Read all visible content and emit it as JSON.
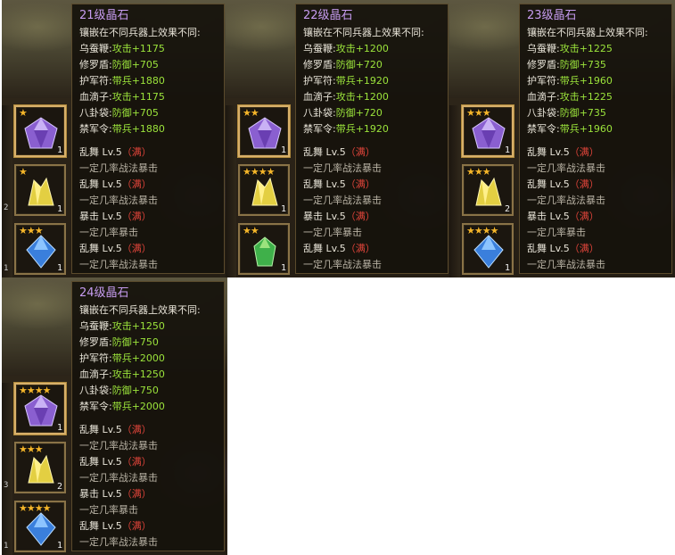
{
  "panels": [
    {
      "title": "21级晶石",
      "header": "镶嵌在不同兵器上效果不同:",
      "stats": [
        {
          "label": "乌蚕鞭:",
          "value": "攻击+1175"
        },
        {
          "label": "修罗盾:",
          "value": "防御+705"
        },
        {
          "label": "护军符:",
          "value": "带兵+1880"
        },
        {
          "label": "血滴子:",
          "value": "攻击+1175"
        },
        {
          "label": "八卦袋:",
          "value": "防御+705"
        },
        {
          "label": "禁军令:",
          "value": "带兵+1880"
        }
      ],
      "slot_qty": [
        "1",
        "1",
        "1"
      ],
      "slot_stars": [
        "★",
        "★",
        "★★★"
      ],
      "edge_nums": [
        "2",
        "1"
      ]
    },
    {
      "title": "22级晶石",
      "header": "镶嵌在不同兵器上效果不同:",
      "stats": [
        {
          "label": "乌蚕鞭:",
          "value": "攻击+1200"
        },
        {
          "label": "修罗盾:",
          "value": "防御+720"
        },
        {
          "label": "护军符:",
          "value": "带兵+1920"
        },
        {
          "label": "血滴子:",
          "value": "攻击+1200"
        },
        {
          "label": "八卦袋:",
          "value": "防御+720"
        },
        {
          "label": "禁军令:",
          "value": "带兵+1920"
        }
      ],
      "slot_qty": [
        "1",
        "1",
        "1"
      ],
      "slot_stars": [
        "★★",
        "★★★★",
        "★★"
      ],
      "edge_nums": [
        "",
        ""
      ]
    },
    {
      "title": "23级晶石",
      "header": "镶嵌在不同兵器上效果不同:",
      "stats": [
        {
          "label": "乌蚕鞭:",
          "value": "攻击+1225"
        },
        {
          "label": "修罗盾:",
          "value": "防御+735"
        },
        {
          "label": "护军符:",
          "value": "带兵+1960"
        },
        {
          "label": "血滴子:",
          "value": "攻击+1225"
        },
        {
          "label": "八卦袋:",
          "value": "防御+735"
        },
        {
          "label": "禁军令:",
          "value": "带兵+1960"
        }
      ],
      "slot_qty": [
        "1",
        "2",
        "1"
      ],
      "slot_stars": [
        "★★★",
        "★★★",
        "★★★★"
      ],
      "edge_nums": [
        "",
        ""
      ]
    },
    {
      "title": "24级晶石",
      "header": "镶嵌在不同兵器上效果不同:",
      "stats": [
        {
          "label": "乌蚕鞭:",
          "value": "攻击+1250"
        },
        {
          "label": "修罗盾:",
          "value": "防御+750"
        },
        {
          "label": "护军符:",
          "value": "带兵+2000"
        },
        {
          "label": "血滴子:",
          "value": "攻击+1250"
        },
        {
          "label": "八卦袋:",
          "value": "防御+750"
        },
        {
          "label": "禁军令:",
          "value": "带兵+2000"
        }
      ],
      "slot_qty": [
        "1",
        "2",
        "1"
      ],
      "slot_stars": [
        "★★★★",
        "★★★",
        "★★★★"
      ],
      "edge_nums": [
        "3",
        "1"
      ]
    }
  ],
  "skills": [
    {
      "name": "乱舞",
      "level": "Lv.5",
      "full": "（满）",
      "desc": "一定几率战法暴击"
    },
    {
      "name": "乱舞",
      "level": "Lv.5",
      "full": "（满）",
      "desc": "一定几率战法暴击"
    },
    {
      "name": "暴击",
      "level": "Lv.5",
      "full": "（满）",
      "desc": "一定几率暴击"
    },
    {
      "name": "乱舞",
      "level": "Lv.5",
      "full": "（满）",
      "desc": "一定几率战法暴击"
    }
  ],
  "colors": {
    "title": "#c79cf0",
    "value": "#9be33b",
    "full": "#e0443a",
    "purple_gem": "#9b6fd6",
    "yellow_gem": "#e8d24a",
    "blue_gem": "#3f86e0",
    "green_gem": "#3fb04a"
  }
}
